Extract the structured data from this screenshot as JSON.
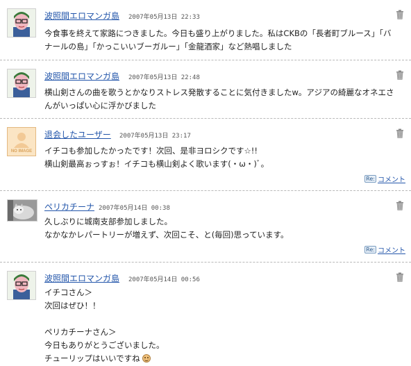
{
  "comments": [
    {
      "avatar": "character-avatar-icon",
      "author": "波照間エロマンガ島",
      "date": "2007年05月13日 22:33",
      "lines": [
        "今食事を終えて家路につきました。今日も盛り上がりました。私はCKBの「長者町ブルース」「バ",
        "ナールの島」「かっこいいブーガルー」「金龍酒家」など熱唱しました"
      ]
    },
    {
      "avatar": "character-avatar-icon",
      "author": "波照間エロマンガ島",
      "date": "2007年05月13日 22:48",
      "lines": [
        "横山剣さんの曲を歌うとかなりストレス発散することに気付きましたw。アジアの綺麗なオネエさ",
        "んがいっぱい心に浮かびました"
      ]
    },
    {
      "avatar": "no-image-avatar-icon",
      "avatar_text": "NO IMAGE",
      "author": "退会したユーザー",
      "date": "2007年05月13日 23:17",
      "lines": [
        "イチコも参加したかったです！次回、是非ヨロシクです☆!!",
        "横山剣最高ぉっすぉ！イチコも横山剣よく歌います(・ω・)ﾞ。"
      ],
      "reply": {
        "badge": "Re:",
        "label": "コメント"
      }
    },
    {
      "avatar": "cat-photo-avatar-icon",
      "author": "ペリカチーナ",
      "date": "2007年05月14日 00:38",
      "lines": [
        "久しぶりに城南支部参加しました。",
        "なかなかレパートリーが増えず、次回こそ、と(毎回)思っています。"
      ],
      "reply": {
        "badge": "Re:",
        "label": "コメント"
      }
    },
    {
      "avatar": "character-avatar-icon",
      "author": "波照間エロマンガ島",
      "date": "2007年05月14日 00:56",
      "lines": [
        "イチコさん＞",
        "次回はぜひ！！",
        "",
        "ペリカチーナさん＞",
        "今日もありがとうございました。",
        "チューリップはいいですね"
      ],
      "last_line_emoji": "smile-emoji-icon"
    }
  ],
  "trash_icon": "trash-icon",
  "colors": {
    "link": "#2255aa",
    "text": "#222222",
    "divider": "#b8b8b8"
  }
}
